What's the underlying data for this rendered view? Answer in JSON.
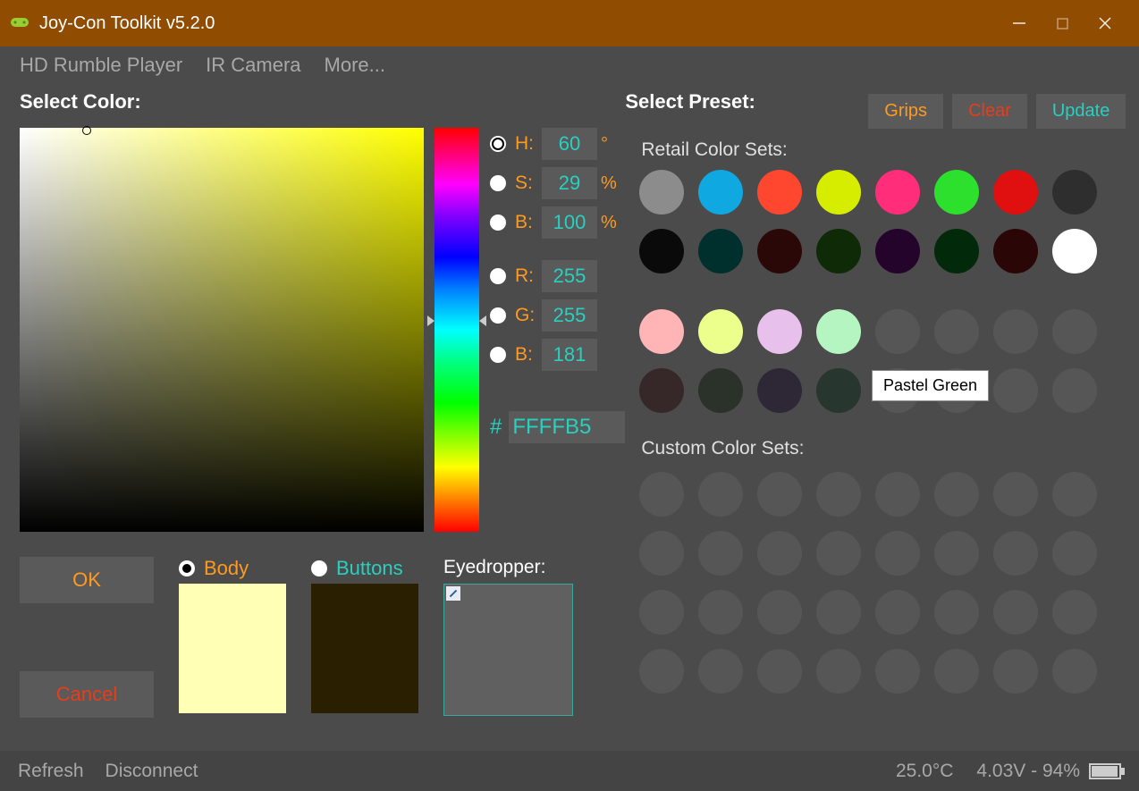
{
  "window": {
    "title": "Joy-Con Toolkit v5.2.0"
  },
  "menu": {
    "items": [
      "HD Rumble Player",
      "IR Camera",
      "More..."
    ]
  },
  "color_panel": {
    "title": "Select Color:",
    "hsb_labels": [
      "H:",
      "S:",
      "B:"
    ],
    "hsb_units": [
      "°",
      "%",
      "%"
    ],
    "hsb_values": [
      "60",
      "29",
      "100"
    ],
    "rgb_labels": [
      "R:",
      "G:",
      "B:"
    ],
    "rgb_values": [
      "255",
      "255",
      "181"
    ],
    "hex_prefix": "#",
    "hex_value": "FFFFB5",
    "ok": "OK",
    "cancel": "Cancel",
    "body_label": "Body",
    "buttons_label": "Buttons",
    "body_color": "#FFFFB5",
    "buttons_color": "#2a2000",
    "eyedropper_label": "Eyedropper:"
  },
  "presets": {
    "title": "Select Preset:",
    "grips": "Grips",
    "clear": "Clear",
    "update": "Update",
    "retail_label": "Retail Color Sets:",
    "custom_label": "Custom Color Sets:",
    "retail_colors_row1": [
      "#8c8c8c",
      "#10a8e0",
      "#ff4730",
      "#d6ed00",
      "#ff2d7a",
      "#2de02d",
      "#e01010",
      "#2e2e2e"
    ],
    "retail_colors_row2": [
      "#0a0a0a",
      "#00302e",
      "#2a0808",
      "#0f2a06",
      "#24042a",
      "#022a0a",
      "#2a0606",
      "#ffffff"
    ],
    "retail_colors_row3": [
      "#ffb5b5",
      "#ecff8c",
      "#e8c0ec",
      "#b5f5c2"
    ],
    "retail_colors_row4": [
      "#362828",
      "#2a322a",
      "#2e2836",
      "#283630"
    ],
    "tooltip_text": "Pastel Green"
  },
  "status": {
    "refresh": "Refresh",
    "disconnect": "Disconnect",
    "temp": "25.0°C",
    "power": "4.03V - 94%"
  }
}
